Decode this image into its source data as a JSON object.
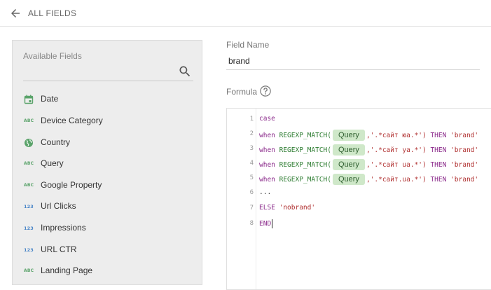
{
  "header": {
    "back_label": "ALL FIELDS"
  },
  "sidebar": {
    "title": "Available Fields",
    "fields": [
      {
        "label": "Date",
        "type": "date"
      },
      {
        "label": "Device Category",
        "type": "text",
        "type_glyph": "ABC"
      },
      {
        "label": "Country",
        "type": "geo"
      },
      {
        "label": "Query",
        "type": "text",
        "type_glyph": "ABC"
      },
      {
        "label": "Google Property",
        "type": "text",
        "type_glyph": "ABC"
      },
      {
        "label": "Url Clicks",
        "type": "number",
        "type_glyph": "123"
      },
      {
        "label": "Impressions",
        "type": "number",
        "type_glyph": "123"
      },
      {
        "label": "URL CTR",
        "type": "number",
        "type_glyph": "123"
      },
      {
        "label": "Landing Page",
        "type": "text",
        "type_glyph": "ABC"
      }
    ]
  },
  "field_name": {
    "label": "Field Name",
    "value": "brand"
  },
  "formula": {
    "label": "Formula",
    "lines": [
      {
        "n": "1",
        "t1": "case"
      },
      {
        "n": "2",
        "t1": "when ",
        "fn": "REGEXP_MATCH(",
        "chip": "Query",
        "str": ",'.*сайт юа.*')",
        "t2": " THEN ",
        "str2": "'brand'"
      },
      {
        "n": "3",
        "t1": "when ",
        "fn": "REGEXP_MATCH(",
        "chip": "Query",
        "str": ",'.*сайт уа.*')",
        "t2": " THEN ",
        "str2": "'brand'"
      },
      {
        "n": "4",
        "t1": "when ",
        "fn": "REGEXP_MATCH(",
        "chip": "Query",
        "str": ",'.*сайт ua.*')",
        "t2": " THEN ",
        "str2": "'brand'"
      },
      {
        "n": "5",
        "t1": "when ",
        "fn": "REGEXP_MATCH(",
        "chip": "Query",
        "str": ",'.*сайт.ua.*')",
        "t2": " THEN ",
        "str2": "'brand'"
      },
      {
        "n": "6",
        "t1": "..."
      },
      {
        "n": "7",
        "t1": "ELSE ",
        "str": "'nobrand'"
      },
      {
        "n": "8",
        "t1": "END"
      }
    ]
  },
  "colors": {
    "accent_text_type": "#5aa36a",
    "accent_number_type": "#4a86c8",
    "chip_bg": "#cfe8c9",
    "panel_bg": "#ededed"
  }
}
